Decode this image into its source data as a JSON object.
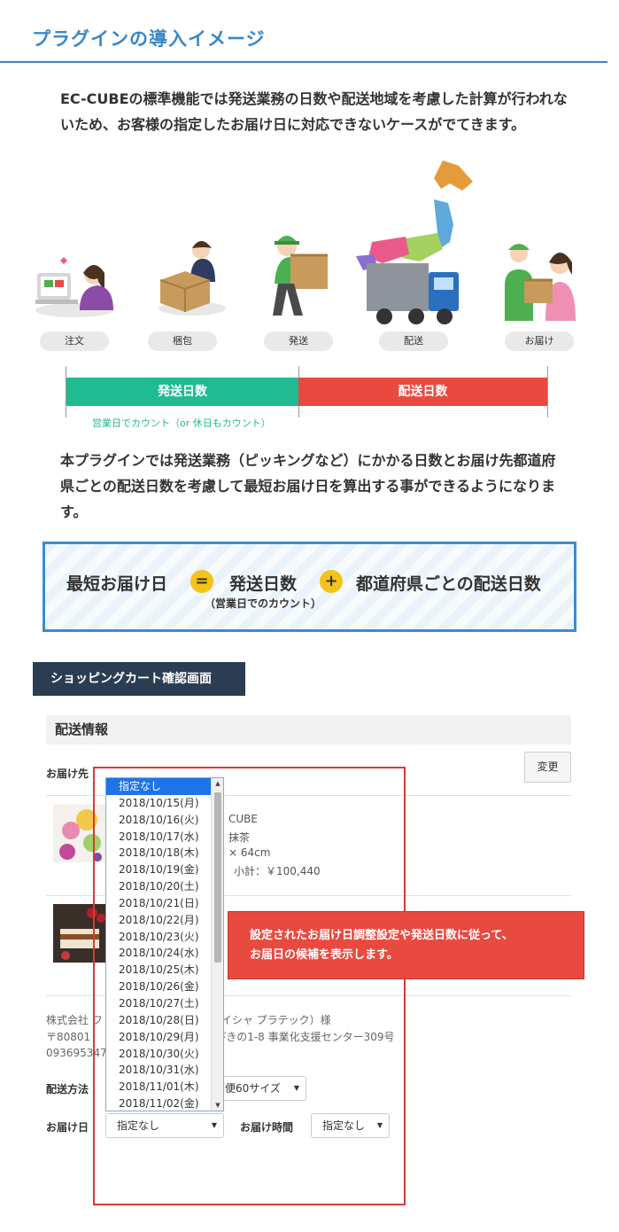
{
  "page": {
    "title": "プラグインの導入イメージ",
    "intro": "EC-CUBEの標準機能では発送業務の日数や配送地域を考慮した計算が行われないため、お客様の指定したお届け日に対応できないケースがでてきます。",
    "description": "本プラグインでは発送業務（ピッキングなど）にかかる日数とお届け先都道府県ごとの配送日数を考慮して最短お届け日を算出する事ができるようになります。"
  },
  "flow": {
    "steps": [
      "注文",
      "梱包",
      "発送",
      "配送",
      "お届け"
    ],
    "shipping_days_label": "発送日数",
    "delivery_days_label": "配送日数",
    "shipping_note": "営業日でカウント（or 休日もカウント）",
    "colors": {
      "shipping": "#1fbb91",
      "delivery": "#e84a3f"
    }
  },
  "formula": {
    "result": "最短お届け日",
    "equals": "=",
    "term1": "発送日数",
    "plus": "+",
    "term2": "都道府県ごとの配送日数",
    "note": "（営業日でのカウント）"
  },
  "section_label": "ショッピングカート確認画面",
  "cart": {
    "header": "配送情報",
    "destination_label": "お届け先",
    "change_button": "変更",
    "product1": {
      "line1": "CUBE",
      "line2": "抹茶",
      "line3": "× 64cm",
      "subtotal": "小計：￥100,440"
    },
    "address": {
      "line1_left": "株式会社 フ",
      "line1_right": "イシャ プラテック）様",
      "line2_left": "〒80801",
      "line2_right": "区ひびきの1-8 事業化支援センター309号",
      "line3": "093695347"
    },
    "shipping_method_label": "配送方法",
    "shipping_method_value": "便60サイズ",
    "delivery_date_label": "お届け日",
    "delivery_date_value": "指定なし",
    "delivery_time_label": "お届け時間",
    "delivery_time_value": "指定なし"
  },
  "dropdown": {
    "options": [
      "指定なし",
      "2018/10/15(月)",
      "2018/10/16(火)",
      "2018/10/17(水)",
      "2018/10/18(木)",
      "2018/10/19(金)",
      "2018/10/20(土)",
      "2018/10/21(日)",
      "2018/10/22(月)",
      "2018/10/23(火)",
      "2018/10/24(水)",
      "2018/10/25(木)",
      "2018/10/26(金)",
      "2018/10/27(土)",
      "2018/10/28(日)",
      "2018/10/29(月)",
      "2018/10/30(火)",
      "2018/10/31(水)",
      "2018/11/01(木)",
      "2018/11/02(金)"
    ],
    "selected": "指定なし"
  },
  "callout": {
    "line1": "設定されたお届け日調整設定や発送日数に従って、",
    "line2": "お届日の候補を表示します。"
  }
}
